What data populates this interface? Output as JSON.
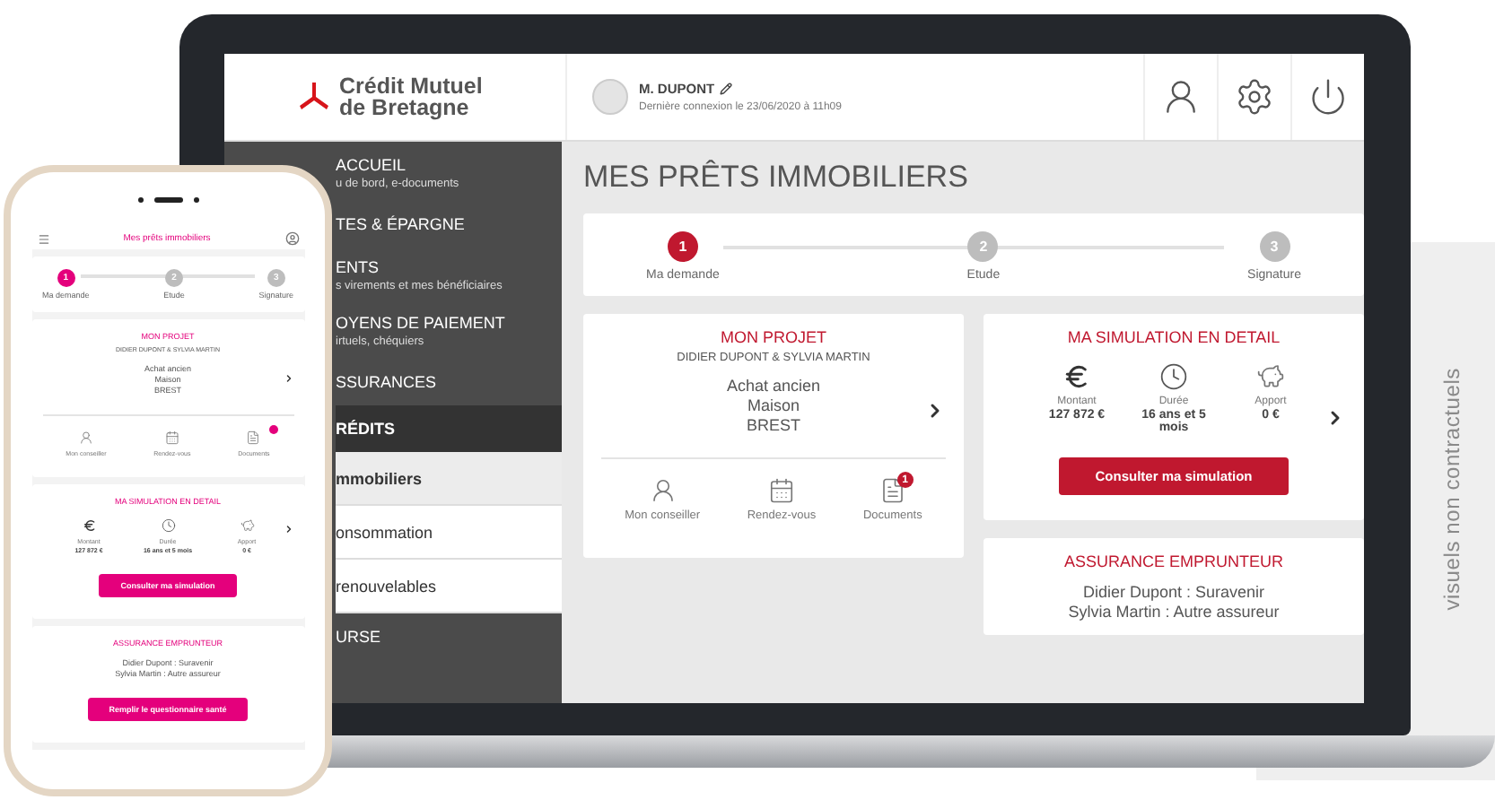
{
  "header": {
    "brand_line1": "Crédit Mutuel",
    "brand_line2": "de Bretagne",
    "user_name": "M. DUPONT",
    "last_login": "Dernière connexion le 23/06/2020 à 11h09"
  },
  "sidebar": {
    "items": [
      {
        "label": "ACCUEIL",
        "sublabel": "u de bord, e-documents",
        "expanded": false
      },
      {
        "label": "TES & ÉPARGNE",
        "expanded": false
      },
      {
        "label": "ENTS",
        "sublabel": "s virements et mes bénéficiaires",
        "expanded": false
      },
      {
        "label": "OYENS DE PAIEMENT",
        "sublabel": "irtuels, chéquiers",
        "expanded": false
      },
      {
        "label": "SSURANCES",
        "expanded": false
      },
      {
        "label": "RÉDITS",
        "expanded": true,
        "children": [
          {
            "label": "mmobiliers",
            "selected": true
          },
          {
            "label": "onsommation",
            "selected": false
          },
          {
            "label": "renouvelables",
            "selected": false
          }
        ]
      },
      {
        "label": "URSE",
        "expanded": false
      }
    ]
  },
  "page_title": "MES PRÊTS IMMOBILIERS",
  "steps": [
    {
      "number": "1",
      "label": "Ma demande",
      "selected": true
    },
    {
      "number": "2",
      "label": "Etude",
      "selected": false
    },
    {
      "number": "3",
      "label": "Signature",
      "selected": false
    }
  ],
  "project_card": {
    "title": "MON PROJET",
    "owners": "DIDIER DUPONT & SYLVIA MARTIN",
    "lines": [
      "Achat ancien",
      "Maison",
      "BREST"
    ],
    "shortcuts": [
      {
        "kind": "advisor",
        "label": "Mon conseiller"
      },
      {
        "kind": "calendar",
        "label": "Rendez-vous"
      },
      {
        "kind": "documents",
        "label": "Documents",
        "badge": "1"
      }
    ]
  },
  "simulation_card": {
    "title": "MA SIMULATION EN DETAIL",
    "stats": [
      {
        "kind": "amount",
        "label": "Montant",
        "value": "127 872 €"
      },
      {
        "kind": "duration",
        "label": "Durée",
        "value": "16 ans et 5 mois"
      },
      {
        "kind": "contribution",
        "label": "Apport",
        "value": "0 €"
      }
    ],
    "button": "Consulter ma simulation"
  },
  "insurance_card": {
    "title": "ASSURANCE EMPRUNTEUR",
    "lines": [
      "Didier Dupont : Suravenir",
      "Sylvia Martin : Autre assureur"
    ]
  },
  "phone": {
    "title": "Mes prêts immobiliers",
    "steps": [
      {
        "number": "1",
        "label": "Ma demande",
        "selected": true
      },
      {
        "number": "2",
        "label": "Etude",
        "selected": false
      },
      {
        "number": "3",
        "label": "Signature",
        "selected": false
      }
    ],
    "project_card": {
      "title": "MON PROJET",
      "owners": "DIDIER DUPONT & SYLVIA MARTIN",
      "lines": [
        "Achat ancien",
        "Maison",
        "BREST"
      ],
      "shortcuts": [
        {
          "kind": "advisor",
          "label": "Mon conseiller"
        },
        {
          "kind": "calendar",
          "label": "Rendez-vous"
        },
        {
          "kind": "documents",
          "label": "Documents",
          "badge_dot": true
        }
      ]
    },
    "simulation_card": {
      "title": "MA SIMULATION EN DETAIL",
      "stats": [
        {
          "kind": "amount",
          "label": "Montant",
          "value": "127 872 €"
        },
        {
          "kind": "duration",
          "label": "Durée",
          "value": "16 ans et 5 mois"
        },
        {
          "kind": "contribution",
          "label": "Apport",
          "value": "0 €"
        }
      ],
      "button": "Consulter ma simulation"
    },
    "insurance_card": {
      "title": "ASSURANCE EMPRUNTEUR",
      "lines": [
        "Didier Dupont : Suravenir",
        "Sylvia Martin : Autre assureur"
      ],
      "button": "Remplir le questionnaire santé"
    }
  },
  "disclaimer": "visuels non contractuels"
}
